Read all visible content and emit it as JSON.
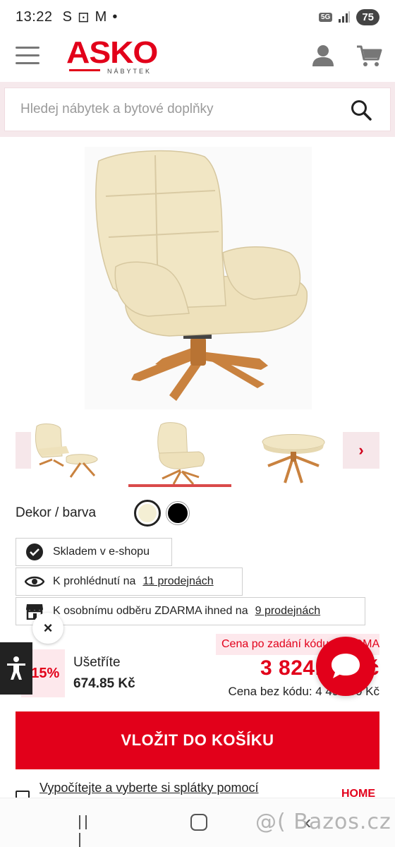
{
  "status_bar": {
    "time": "13:22",
    "notifications": [
      "S",
      "⊡",
      "M",
      "•"
    ],
    "network": "5G",
    "battery": "75"
  },
  "header": {
    "logo_text": "ASKO",
    "logo_sub": "NÁBYTEK",
    "brand_color": "#e2001a",
    "icons": [
      "menu-icon",
      "user-icon",
      "cart-icon"
    ]
  },
  "search": {
    "placeholder": "Hledej nábytek a bytové doplňky"
  },
  "gallery": {
    "prev_label": "‹",
    "next_label": "›",
    "active_thumbnail": 2,
    "thumbnail_count": 3
  },
  "decor": {
    "label": "Dekor / barva",
    "options": [
      {
        "name": "cream",
        "color": "#f4efd4",
        "selected": true
      },
      {
        "name": "black",
        "color": "#000000",
        "selected": false
      }
    ]
  },
  "availability": {
    "stock_text": "Skladem v e-shopu",
    "view_text": "K prohlédnutí na",
    "view_link": "11 prodejnách",
    "pickup_text": "K osobnímu odběru ZDARMA ihned na",
    "pickup_link": "9 prodejnách"
  },
  "price": {
    "discount": "-15%",
    "save_label": "Ušetříte",
    "save_value": "674.85 Kč",
    "code_banner": "Cena po zadání kódu ASKOMA",
    "price": "3 824.15 Kč",
    "price_without_code": "Cena bez kódu: 4 499.00 Kč"
  },
  "cart": {
    "button_label": "VLOŽIT DO KOŠÍKU"
  },
  "installment": {
    "link_text": "Vypočítejte a vyberte si splátky pomocí",
    "brand": "HOME"
  },
  "widgets": {
    "close_label": "×"
  },
  "watermark": "@( Bazos.cz"
}
